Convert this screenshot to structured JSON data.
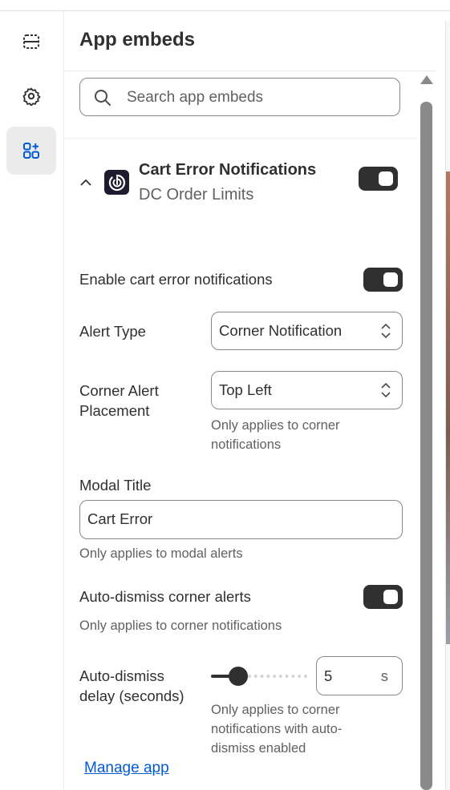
{
  "rail": {
    "items": [
      {
        "name": "sections",
        "icon": "sections-icon"
      },
      {
        "name": "settings",
        "icon": "gear-icon"
      },
      {
        "name": "app-embeds",
        "icon": "apps-icon",
        "active": true
      }
    ]
  },
  "panel": {
    "title": "App embeds",
    "search_placeholder": "Search app embeds"
  },
  "embed": {
    "name": "Cart Error Notifications",
    "app": "DC Order Limits",
    "enabled": true
  },
  "settings": {
    "enable_label": "Enable cart error notifications",
    "enable_on": true,
    "alert_type_label": "Alert Type",
    "alert_type_value": "Corner Notification",
    "placement_label_line1": "Corner Alert",
    "placement_label_line2": "Placement",
    "placement_value": "Top Left",
    "placement_help_line1": "Only applies to corner",
    "placement_help_line2": "notifications",
    "modal_title_label": "Modal Title",
    "modal_title_value": "Cart Error",
    "modal_title_help": "Only applies to modal alerts",
    "auto_dismiss_label": "Auto-dismiss corner alerts",
    "auto_dismiss_on": true,
    "auto_dismiss_help": "Only applies to corner notifications",
    "delay_label_line1": "Auto-dismiss",
    "delay_label_line2": "delay (seconds)",
    "delay_value": "5",
    "delay_slider_fraction": 0.28,
    "delay_suffix": "s",
    "delay_help_line1": "Only applies to corner",
    "delay_help_line2": "notifications with auto-",
    "delay_help_line3": "dismiss enabled"
  },
  "footer": {
    "manage_link": "Manage app"
  },
  "colors": {
    "accent": "#005bd3",
    "toggle_on": "#303030"
  }
}
